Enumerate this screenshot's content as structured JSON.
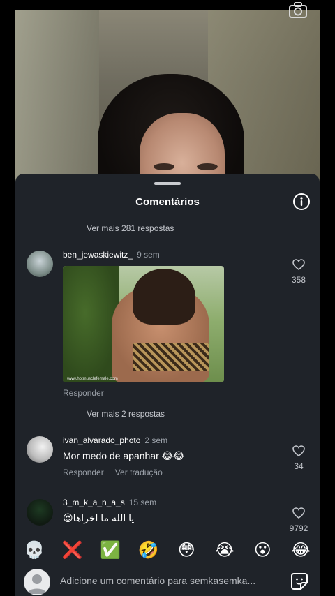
{
  "sheet": {
    "title": "Comentários"
  },
  "top_more_replies": "Ver mais 281 respostas",
  "comments": [
    {
      "username": "ben_jewaskiewitz_",
      "time": "9 sem",
      "gif_watermark": "www.hotmusclefemale.com",
      "reply_label": "Responder",
      "likes": "358"
    },
    {
      "username": "ivan_alvarado_photo",
      "time": "2 sem",
      "text": "Mor medo de apanhar 😂😂",
      "reply_label": "Responder",
      "translate_label": "Ver tradução",
      "likes": "34"
    },
    {
      "username": "3_m_k_a_n_a_s",
      "time": "15 sem",
      "text": "😍يا الله ما اخراها",
      "likes": "9792"
    }
  ],
  "mid_more_replies": "Ver mais 2 respostas",
  "emoji_bar": [
    "💀",
    "❌",
    "✅",
    "🤣",
    "😳",
    "😭",
    "😮",
    "😂"
  ],
  "input": {
    "placeholder": "Adicione um comentário para semkasemka..."
  },
  "icons": {
    "camera": "camera-icon",
    "info": "info-icon",
    "heart": "heart-icon",
    "sticker": "sticker-icon"
  },
  "colors": {
    "sheet_bg": "#1f2329",
    "muted_text": "#9aa0a8"
  }
}
